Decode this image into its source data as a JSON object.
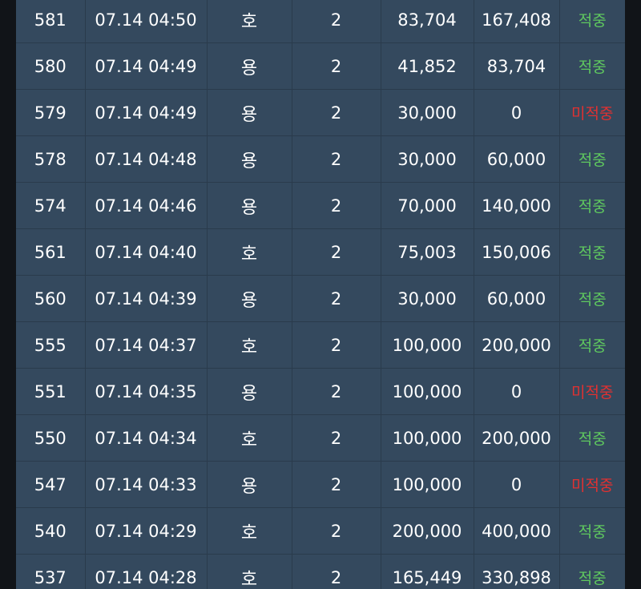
{
  "rows": [
    {
      "id": "581",
      "time": "07.14 04:50",
      "type": "호",
      "count": "2",
      "bet": "83,704",
      "payout": "167,408",
      "result": "적중",
      "status": "win"
    },
    {
      "id": "580",
      "time": "07.14 04:49",
      "type": "용",
      "count": "2",
      "bet": "41,852",
      "payout": "83,704",
      "result": "적중",
      "status": "win"
    },
    {
      "id": "579",
      "time": "07.14 04:49",
      "type": "용",
      "count": "2",
      "bet": "30,000",
      "payout": "0",
      "result": "미적중",
      "status": "lose"
    },
    {
      "id": "578",
      "time": "07.14 04:48",
      "type": "용",
      "count": "2",
      "bet": "30,000",
      "payout": "60,000",
      "result": "적중",
      "status": "win"
    },
    {
      "id": "574",
      "time": "07.14 04:46",
      "type": "용",
      "count": "2",
      "bet": "70,000",
      "payout": "140,000",
      "result": "적중",
      "status": "win"
    },
    {
      "id": "561",
      "time": "07.14 04:40",
      "type": "호",
      "count": "2",
      "bet": "75,003",
      "payout": "150,006",
      "result": "적중",
      "status": "win"
    },
    {
      "id": "560",
      "time": "07.14 04:39",
      "type": "용",
      "count": "2",
      "bet": "30,000",
      "payout": "60,000",
      "result": "적중",
      "status": "win"
    },
    {
      "id": "555",
      "time": "07.14 04:37",
      "type": "호",
      "count": "2",
      "bet": "100,000",
      "payout": "200,000",
      "result": "적중",
      "status": "win"
    },
    {
      "id": "551",
      "time": "07.14 04:35",
      "type": "용",
      "count": "2",
      "bet": "100,000",
      "payout": "0",
      "result": "미적중",
      "status": "lose"
    },
    {
      "id": "550",
      "time": "07.14 04:34",
      "type": "호",
      "count": "2",
      "bet": "100,000",
      "payout": "200,000",
      "result": "적중",
      "status": "win"
    },
    {
      "id": "547",
      "time": "07.14 04:33",
      "type": "용",
      "count": "2",
      "bet": "100,000",
      "payout": "0",
      "result": "미적중",
      "status": "lose"
    },
    {
      "id": "540",
      "time": "07.14 04:29",
      "type": "호",
      "count": "2",
      "bet": "200,000",
      "payout": "400,000",
      "result": "적중",
      "status": "win"
    },
    {
      "id": "537",
      "time": "07.14 04:28",
      "type": "호",
      "count": "2",
      "bet": "165,449",
      "payout": "330,898",
      "result": "적중",
      "status": "win"
    }
  ],
  "colors": {
    "table_bg": "#34495e",
    "text": "#ffffff",
    "win": "#5fc85f",
    "lose": "#e03131",
    "page_bg": "#111418"
  }
}
